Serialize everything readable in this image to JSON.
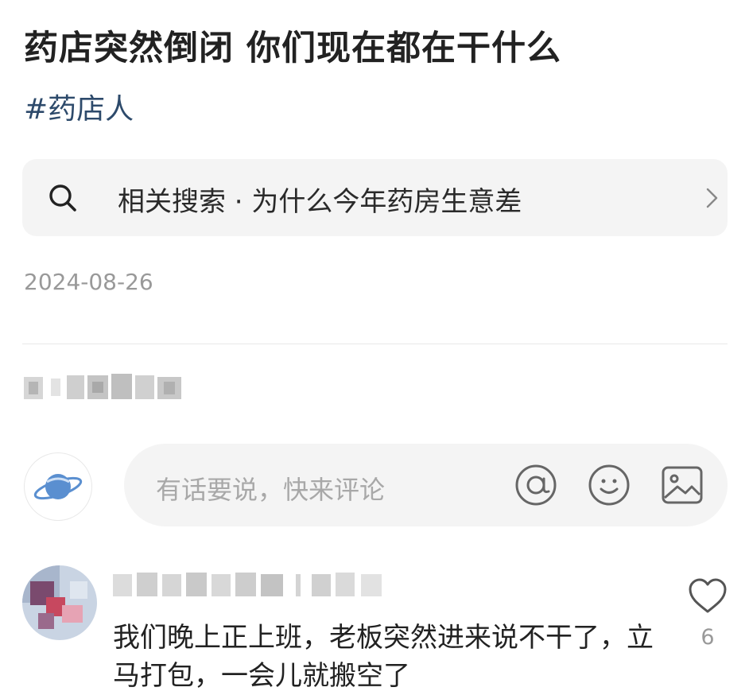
{
  "post": {
    "title": "药店突然倒闭 你们现在都在干什么",
    "hashtag": "#药店人",
    "date": "2024-08-26"
  },
  "related_search": {
    "label": "相关搜索 · 为什么今年药房生意差",
    "search_icon": "search-icon",
    "chevron_icon": "chevron-right-icon"
  },
  "comment_input": {
    "placeholder": "有话要说，快来评论",
    "icons": [
      "at-icon",
      "emoji-icon",
      "image-icon"
    ]
  },
  "comments": [
    {
      "text": "我们晚上正上班，老板突然进来说不干了，立马打包，一会儿就搬空了",
      "likes": "6"
    }
  ],
  "colors": {
    "tag": "#2d4a6b",
    "muted": "#999999",
    "input_bg": "#f4f4f4"
  }
}
